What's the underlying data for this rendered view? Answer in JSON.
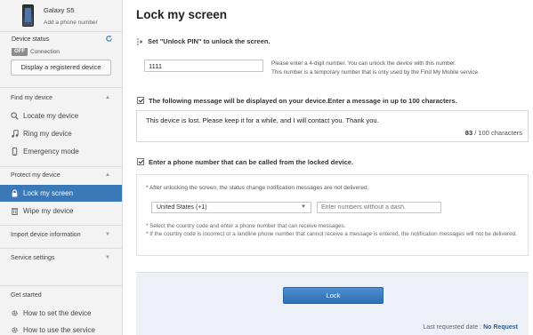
{
  "device": {
    "name": "Galaxy S5",
    "add_phone": "Add a phone number",
    "status_label": "Device status",
    "status_badge": "OFF",
    "connection": "Connection",
    "display_button": "Display a registered device"
  },
  "sidebar": {
    "find_title": "Find my device",
    "find_items": [
      {
        "label": "Locate my device",
        "icon": "search-icon"
      },
      {
        "label": "Ring my device",
        "icon": "music-note-icon"
      },
      {
        "label": "Emergency mode",
        "icon": "phone-icon"
      }
    ],
    "protect_title": "Protect my device",
    "protect_items": [
      {
        "label": "Lock my screen",
        "icon": "lock-icon"
      },
      {
        "label": "Wipe my device",
        "icon": "trash-icon"
      }
    ],
    "import_title": "Import device information",
    "service_title": "Service settings",
    "get_started_title": "Get started",
    "get_started_items": [
      {
        "label": "How to set the device",
        "icon": "gear-icon"
      },
      {
        "label": "How to use the service",
        "icon": "gear-icon"
      }
    ]
  },
  "main": {
    "title": "Lock my screen",
    "pin_header": "Set \"Unlock PIN\" to unlock the screen.",
    "pin_value": "1111",
    "pin_desc_1": "Please enter a 4-digit number. You can unlock the device with this number.",
    "pin_desc_2": "This number is a temporary number that is only used by the Find My Mobile service.",
    "message_header": "The following message will be displayed on your device.Enter a message in up to 100 characters.",
    "message_text": "This device is lost. Please keep it for a while, and I will contact you. Thank you.",
    "char_count": "83",
    "char_max": "/ 100 characters",
    "phone_header": "Enter a phone number that can be called from the locked device.",
    "phone_note_1": "* After unlocking the screen, the status change notification messages are not delivered.",
    "country_value": "United States (+1)",
    "phone_placeholder": "Enter numbers without a dash.",
    "phone_note_2": "* Select the country code and enter a phone number that can receive messages.",
    "phone_note_3": "* If the country code is incorrect or a landline phone number that cannot receive a message is entered, the notification messages will not be delivered.",
    "lock_button": "Lock",
    "last_requested_label": "Last requested date :",
    "last_requested_value": "No Request"
  },
  "colors": {
    "accent": "#3a78b8",
    "lock_button": "#3a7cc1",
    "footer_bg": "#eef0f7"
  }
}
